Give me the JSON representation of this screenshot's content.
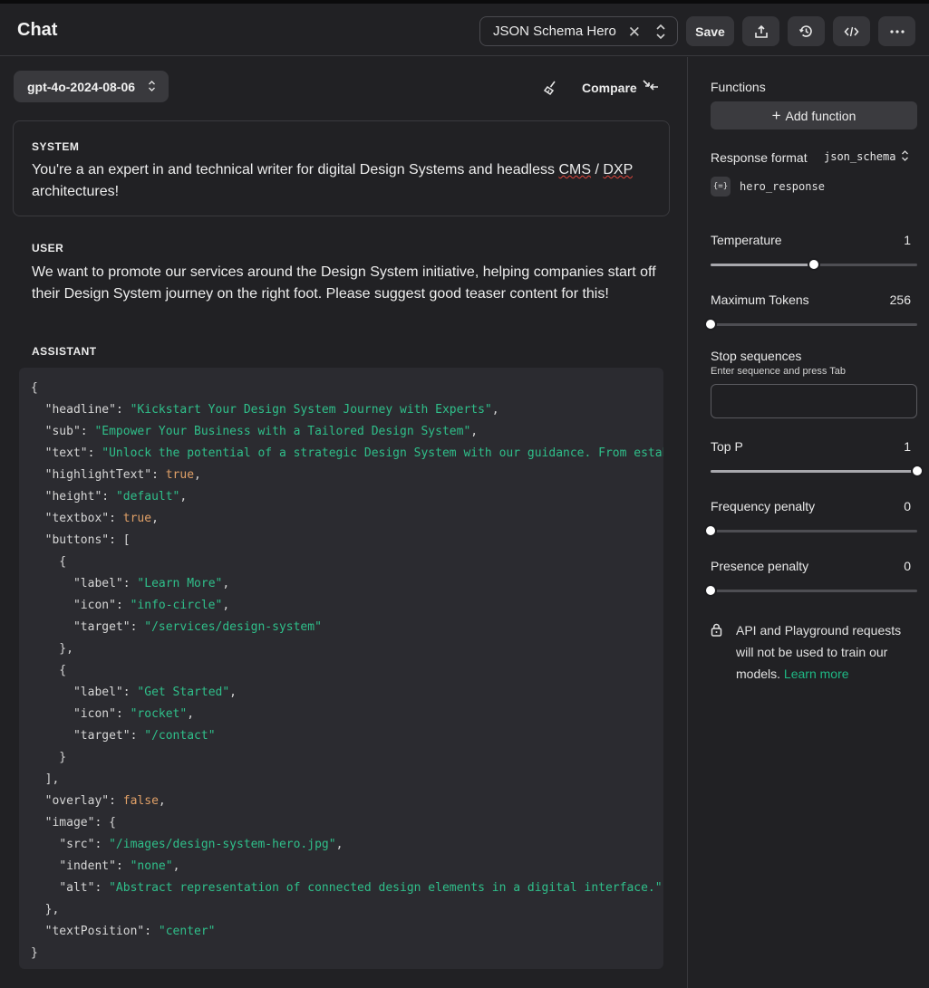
{
  "header": {
    "title": "Chat",
    "preset_name": "JSON Schema Hero",
    "save_label": "Save",
    "icons": [
      "share-icon",
      "history-icon",
      "code-icon",
      "more-icon"
    ]
  },
  "toolbar": {
    "model": "gpt-4o-2024-08-06",
    "compare_label": "Compare"
  },
  "messages": {
    "system": {
      "role": "SYSTEM",
      "text_before": "You're a an expert in and technical writer for digital Design Systems and headless ",
      "cms": "CMS",
      "slash": " / ",
      "dxp": "DXP",
      "text_after": " architectures!"
    },
    "user": {
      "role": "USER",
      "text": "We want to promote our services around the Design System initiative, helping companies start off their Design System journey on the right foot. Please suggest good teaser content for this!"
    },
    "assistant": {
      "role": "ASSISTANT"
    }
  },
  "code": {
    "headline_key": "\"headline\"",
    "headline_val": "\"Kickstart Your Design System Journey with Experts\"",
    "sub_key": "\"sub\"",
    "sub_val": "\"Empower Your Business with a Tailored Design System\"",
    "text_key": "\"text\"",
    "text_val": "\"Unlock the potential of a strategic Design System with our guidance. From estab",
    "highlight_key": "\"highlightText\"",
    "highlight_val": "true",
    "height_key": "\"height\"",
    "height_val": "\"default\"",
    "textbox_key": "\"textbox\"",
    "textbox_val": "true",
    "buttons_key": "\"buttons\"",
    "label_key": "\"label\"",
    "icon_key": "\"icon\"",
    "target_key": "\"target\"",
    "btn1_label": "\"Learn More\"",
    "btn1_icon": "\"info-circle\"",
    "btn1_target": "\"/services/design-system\"",
    "btn2_label": "\"Get Started\"",
    "btn2_icon": "\"rocket\"",
    "btn2_target": "\"/contact\"",
    "overlay_key": "\"overlay\"",
    "overlay_val": "false",
    "image_key": "\"image\"",
    "src_key": "\"src\"",
    "src_val": "\"/images/design-system-hero.jpg\"",
    "indent_key": "\"indent\"",
    "indent_val": "\"none\"",
    "alt_key": "\"alt\"",
    "alt_val": "\"Abstract representation of connected design elements in a digital interface.\"",
    "textpos_key": "\"textPosition\"",
    "textpos_val": "\"center\""
  },
  "settings": {
    "functions_label": "Functions",
    "add_function_label": "Add function",
    "response_format_label": "Response format",
    "response_format_value": "json_schema",
    "schema_badge": "{=}",
    "schema_name": "hero_response",
    "temperature": {
      "label": "Temperature",
      "value": "1",
      "fraction": 0.5
    },
    "max_tokens": {
      "label": "Maximum Tokens",
      "value": "256",
      "fraction": 0.0
    },
    "stop_sequences": {
      "label": "Stop sequences",
      "hint": "Enter sequence and press Tab"
    },
    "top_p": {
      "label": "Top P",
      "value": "1",
      "fraction": 1.0
    },
    "frequency_penalty": {
      "label": "Frequency penalty",
      "value": "0",
      "fraction": 0.0
    },
    "presence_penalty": {
      "label": "Presence penalty",
      "value": "0",
      "fraction": 0.0
    },
    "privacy_text": "API and Playground requests will not be used to train our models. ",
    "privacy_link": "Learn more"
  },
  "colors": {
    "background": "#212124",
    "code_background": "#2b2b30",
    "string": "#2fbf8a",
    "boolean": "#e0a067",
    "link": "#1fb884"
  }
}
